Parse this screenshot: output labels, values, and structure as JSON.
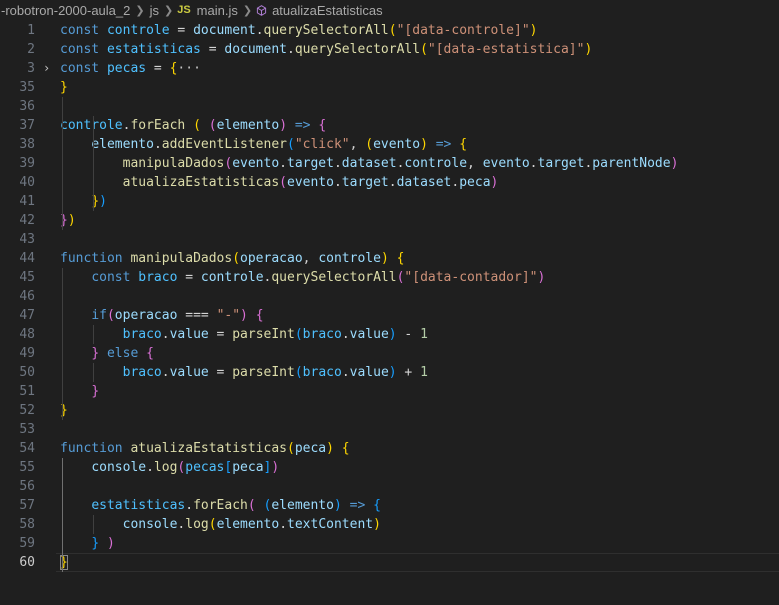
{
  "breadcrumb": {
    "folder": "-robotron-2000-aula_2",
    "subfolder": "js",
    "file_badge": "JS",
    "file": "main.js",
    "symbol": "atualizaEstatisticas"
  },
  "editor": {
    "language": "javascript",
    "current_line": 60,
    "lines": [
      {
        "num": "1",
        "tokens": [
          [
            "k",
            "const "
          ],
          [
            "c",
            "controle"
          ],
          [
            "p",
            " = "
          ],
          [
            "v",
            "document"
          ],
          [
            "p",
            "."
          ],
          [
            "f",
            "querySelectorAll"
          ],
          [
            "b1",
            "("
          ],
          [
            "s",
            "\"[data-controle]\""
          ],
          [
            "b1",
            ")"
          ]
        ]
      },
      {
        "num": "2",
        "tokens": [
          [
            "k",
            "const "
          ],
          [
            "c",
            "estatisticas"
          ],
          [
            "p",
            " = "
          ],
          [
            "v",
            "document"
          ],
          [
            "p",
            "."
          ],
          [
            "f",
            "querySelectorAll"
          ],
          [
            "b1",
            "("
          ],
          [
            "s",
            "\"[data-estatistica]\""
          ],
          [
            "b1",
            ")"
          ]
        ]
      },
      {
        "num": "3",
        "fold": "›",
        "tokens": [
          [
            "k",
            "const "
          ],
          [
            "c",
            "pecas"
          ],
          [
            "p",
            " = "
          ],
          [
            "b1",
            "{"
          ],
          [
            "dots",
            "···"
          ]
        ]
      },
      {
        "num": "35",
        "tokens": [
          [
            "b1",
            "}"
          ]
        ]
      },
      {
        "num": "36",
        "tokens": []
      },
      {
        "num": "37",
        "tokens": [
          [
            "c",
            "controle"
          ],
          [
            "p",
            "."
          ],
          [
            "f",
            "forEach"
          ],
          [
            "p",
            " "
          ],
          [
            "b1",
            "("
          ],
          [
            "p",
            " "
          ],
          [
            "b2",
            "("
          ],
          [
            "v",
            "elemento"
          ],
          [
            "b2",
            ")"
          ],
          [
            "p",
            " "
          ],
          [
            "k",
            "=>"
          ],
          [
            "p",
            " "
          ],
          [
            "b2",
            "{"
          ]
        ]
      },
      {
        "num": "38",
        "tokens": [
          [
            "p",
            "    "
          ],
          [
            "v",
            "elemento"
          ],
          [
            "p",
            "."
          ],
          [
            "f",
            "addEventListener"
          ],
          [
            "b3",
            "("
          ],
          [
            "s",
            "\"click\""
          ],
          [
            "p",
            ", "
          ],
          [
            "b1",
            "("
          ],
          [
            "v",
            "evento"
          ],
          [
            "b1",
            ")"
          ],
          [
            "p",
            " "
          ],
          [
            "k",
            "=>"
          ],
          [
            "p",
            " "
          ],
          [
            "b1",
            "{"
          ]
        ]
      },
      {
        "num": "39",
        "tokens": [
          [
            "p",
            "        "
          ],
          [
            "f",
            "manipulaDados"
          ],
          [
            "b2",
            "("
          ],
          [
            "v",
            "evento"
          ],
          [
            "p",
            "."
          ],
          [
            "v",
            "target"
          ],
          [
            "p",
            "."
          ],
          [
            "v",
            "dataset"
          ],
          [
            "p",
            "."
          ],
          [
            "v",
            "controle"
          ],
          [
            "p",
            ", "
          ],
          [
            "v",
            "evento"
          ],
          [
            "p",
            "."
          ],
          [
            "v",
            "target"
          ],
          [
            "p",
            "."
          ],
          [
            "v",
            "parentNode"
          ],
          [
            "b2",
            ")"
          ]
        ]
      },
      {
        "num": "40",
        "tokens": [
          [
            "p",
            "        "
          ],
          [
            "f",
            "atualizaEstatisticas"
          ],
          [
            "b2",
            "("
          ],
          [
            "v",
            "evento"
          ],
          [
            "p",
            "."
          ],
          [
            "v",
            "target"
          ],
          [
            "p",
            "."
          ],
          [
            "v",
            "dataset"
          ],
          [
            "p",
            "."
          ],
          [
            "v",
            "peca"
          ],
          [
            "b2",
            ")"
          ]
        ]
      },
      {
        "num": "41",
        "tokens": [
          [
            "p",
            "    "
          ],
          [
            "b1",
            "}"
          ],
          [
            "b3",
            ")"
          ]
        ]
      },
      {
        "num": "42",
        "tokens": [
          [
            "b2",
            "}"
          ],
          [
            "b1",
            ")"
          ]
        ]
      },
      {
        "num": "43",
        "tokens": []
      },
      {
        "num": "44",
        "tokens": [
          [
            "k",
            "function "
          ],
          [
            "f",
            "manipulaDados"
          ],
          [
            "b1",
            "("
          ],
          [
            "v",
            "operacao"
          ],
          [
            "p",
            ", "
          ],
          [
            "v",
            "controle"
          ],
          [
            "b1",
            ")"
          ],
          [
            "p",
            " "
          ],
          [
            "b1",
            "{"
          ]
        ]
      },
      {
        "num": "45",
        "tokens": [
          [
            "p",
            "    "
          ],
          [
            "k",
            "const "
          ],
          [
            "c",
            "braco"
          ],
          [
            "p",
            " = "
          ],
          [
            "v",
            "controle"
          ],
          [
            "p",
            "."
          ],
          [
            "f",
            "querySelectorAll"
          ],
          [
            "b2",
            "("
          ],
          [
            "s",
            "\"[data-contador]\""
          ],
          [
            "b2",
            ")"
          ]
        ]
      },
      {
        "num": "46",
        "tokens": []
      },
      {
        "num": "47",
        "tokens": [
          [
            "p",
            "    "
          ],
          [
            "k",
            "if"
          ],
          [
            "b2",
            "("
          ],
          [
            "v",
            "operacao"
          ],
          [
            "p",
            " === "
          ],
          [
            "s",
            "\"-\""
          ],
          [
            "b2",
            ")"
          ],
          [
            "p",
            " "
          ],
          [
            "b2",
            "{"
          ]
        ]
      },
      {
        "num": "48",
        "tokens": [
          [
            "p",
            "        "
          ],
          [
            "c",
            "braco"
          ],
          [
            "p",
            "."
          ],
          [
            "v",
            "value"
          ],
          [
            "p",
            " = "
          ],
          [
            "f",
            "parseInt"
          ],
          [
            "b3",
            "("
          ],
          [
            "c",
            "braco"
          ],
          [
            "p",
            "."
          ],
          [
            "v",
            "value"
          ],
          [
            "b3",
            ")"
          ],
          [
            "p",
            " - "
          ],
          [
            "n",
            "1"
          ]
        ]
      },
      {
        "num": "49",
        "tokens": [
          [
            "p",
            "    "
          ],
          [
            "b2",
            "}"
          ],
          [
            "p",
            " "
          ],
          [
            "k",
            "else"
          ],
          [
            "p",
            " "
          ],
          [
            "b2",
            "{"
          ]
        ]
      },
      {
        "num": "50",
        "tokens": [
          [
            "p",
            "        "
          ],
          [
            "c",
            "braco"
          ],
          [
            "p",
            "."
          ],
          [
            "v",
            "value"
          ],
          [
            "p",
            " = "
          ],
          [
            "f",
            "parseInt"
          ],
          [
            "b3",
            "("
          ],
          [
            "c",
            "braco"
          ],
          [
            "p",
            "."
          ],
          [
            "v",
            "value"
          ],
          [
            "b3",
            ")"
          ],
          [
            "p",
            " + "
          ],
          [
            "n",
            "1"
          ]
        ]
      },
      {
        "num": "51",
        "tokens": [
          [
            "p",
            "    "
          ],
          [
            "b2",
            "}"
          ]
        ]
      },
      {
        "num": "52",
        "tokens": [
          [
            "b1",
            "}"
          ]
        ]
      },
      {
        "num": "53",
        "tokens": []
      },
      {
        "num": "54",
        "tokens": [
          [
            "k",
            "function "
          ],
          [
            "f",
            "atualizaEstatisticas"
          ],
          [
            "b1",
            "("
          ],
          [
            "v",
            "peca"
          ],
          [
            "b1",
            ")"
          ],
          [
            "p",
            " "
          ],
          [
            "b1",
            "{"
          ]
        ]
      },
      {
        "num": "55",
        "tokens": [
          [
            "p",
            "    "
          ],
          [
            "v",
            "console"
          ],
          [
            "p",
            "."
          ],
          [
            "f",
            "log"
          ],
          [
            "b2",
            "("
          ],
          [
            "c",
            "pecas"
          ],
          [
            "b3",
            "["
          ],
          [
            "v",
            "peca"
          ],
          [
            "b3",
            "]"
          ],
          [
            "b2",
            ")"
          ]
        ]
      },
      {
        "num": "56",
        "tokens": []
      },
      {
        "num": "57",
        "tokens": [
          [
            "p",
            "    "
          ],
          [
            "c",
            "estatisticas"
          ],
          [
            "p",
            "."
          ],
          [
            "f",
            "forEach"
          ],
          [
            "b2",
            "("
          ],
          [
            "p",
            " "
          ],
          [
            "b3",
            "("
          ],
          [
            "v",
            "elemento"
          ],
          [
            "b3",
            ")"
          ],
          [
            "p",
            " "
          ],
          [
            "k",
            "=>"
          ],
          [
            "p",
            " "
          ],
          [
            "b3",
            "{"
          ]
        ]
      },
      {
        "num": "58",
        "tokens": [
          [
            "p",
            "        "
          ],
          [
            "v",
            "console"
          ],
          [
            "p",
            "."
          ],
          [
            "f",
            "log"
          ],
          [
            "b1",
            "("
          ],
          [
            "v",
            "elemento"
          ],
          [
            "p",
            "."
          ],
          [
            "v",
            "textContent"
          ],
          [
            "b1",
            ")"
          ]
        ]
      },
      {
        "num": "59",
        "tokens": [
          [
            "p",
            "    "
          ],
          [
            "b3",
            "}"
          ],
          [
            "p",
            " "
          ],
          [
            "b2",
            ")"
          ]
        ]
      },
      {
        "num": "60",
        "tokens": [
          [
            "b1",
            "}"
          ]
        ]
      }
    ]
  },
  "colors": {
    "background": "#1f1f1f",
    "keyword": "#569cd6",
    "variable": "#9cdcfe",
    "constant": "#4fc1ff",
    "function": "#dcdcaa",
    "string": "#ce9178",
    "number": "#b5cea8"
  },
  "icons": {
    "chevron": "chevron-right-icon",
    "function_symbol": "cube-symbol-icon",
    "fold": "chevron-right-icon"
  }
}
